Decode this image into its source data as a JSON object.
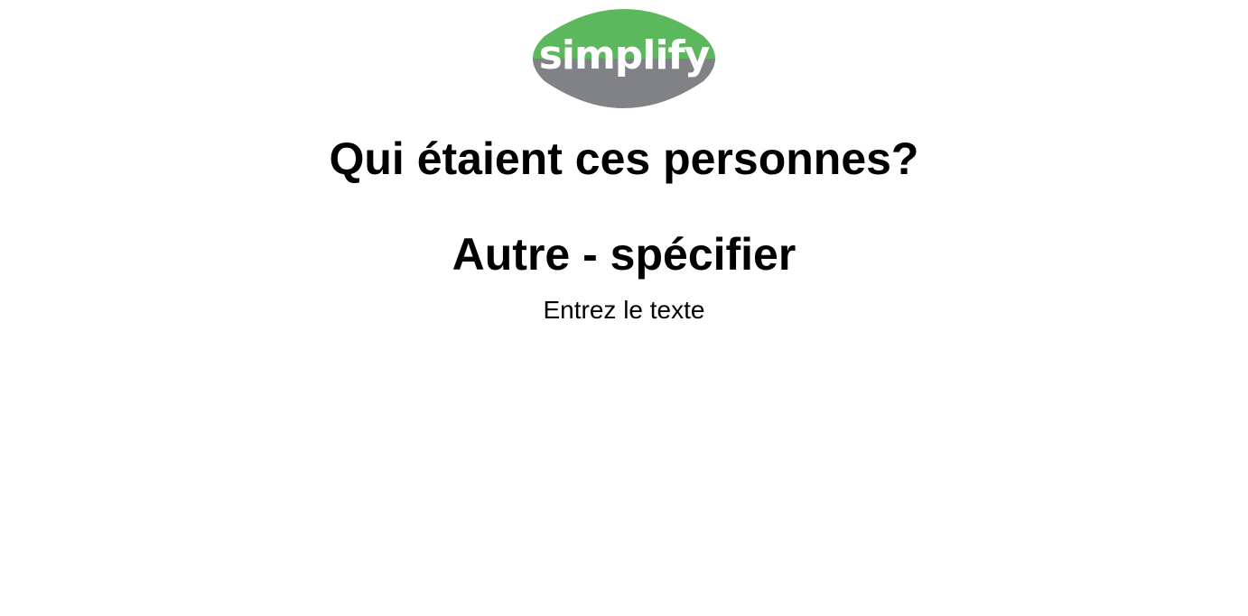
{
  "logo": {
    "text": "simplify",
    "top_color": "#5cb85c",
    "bottom_color": "#808285",
    "text_color": "#ffffff"
  },
  "question": "Qui étaient ces personnes?",
  "answer": "Autre - spécifier",
  "input_prompt": "Entrez le texte"
}
